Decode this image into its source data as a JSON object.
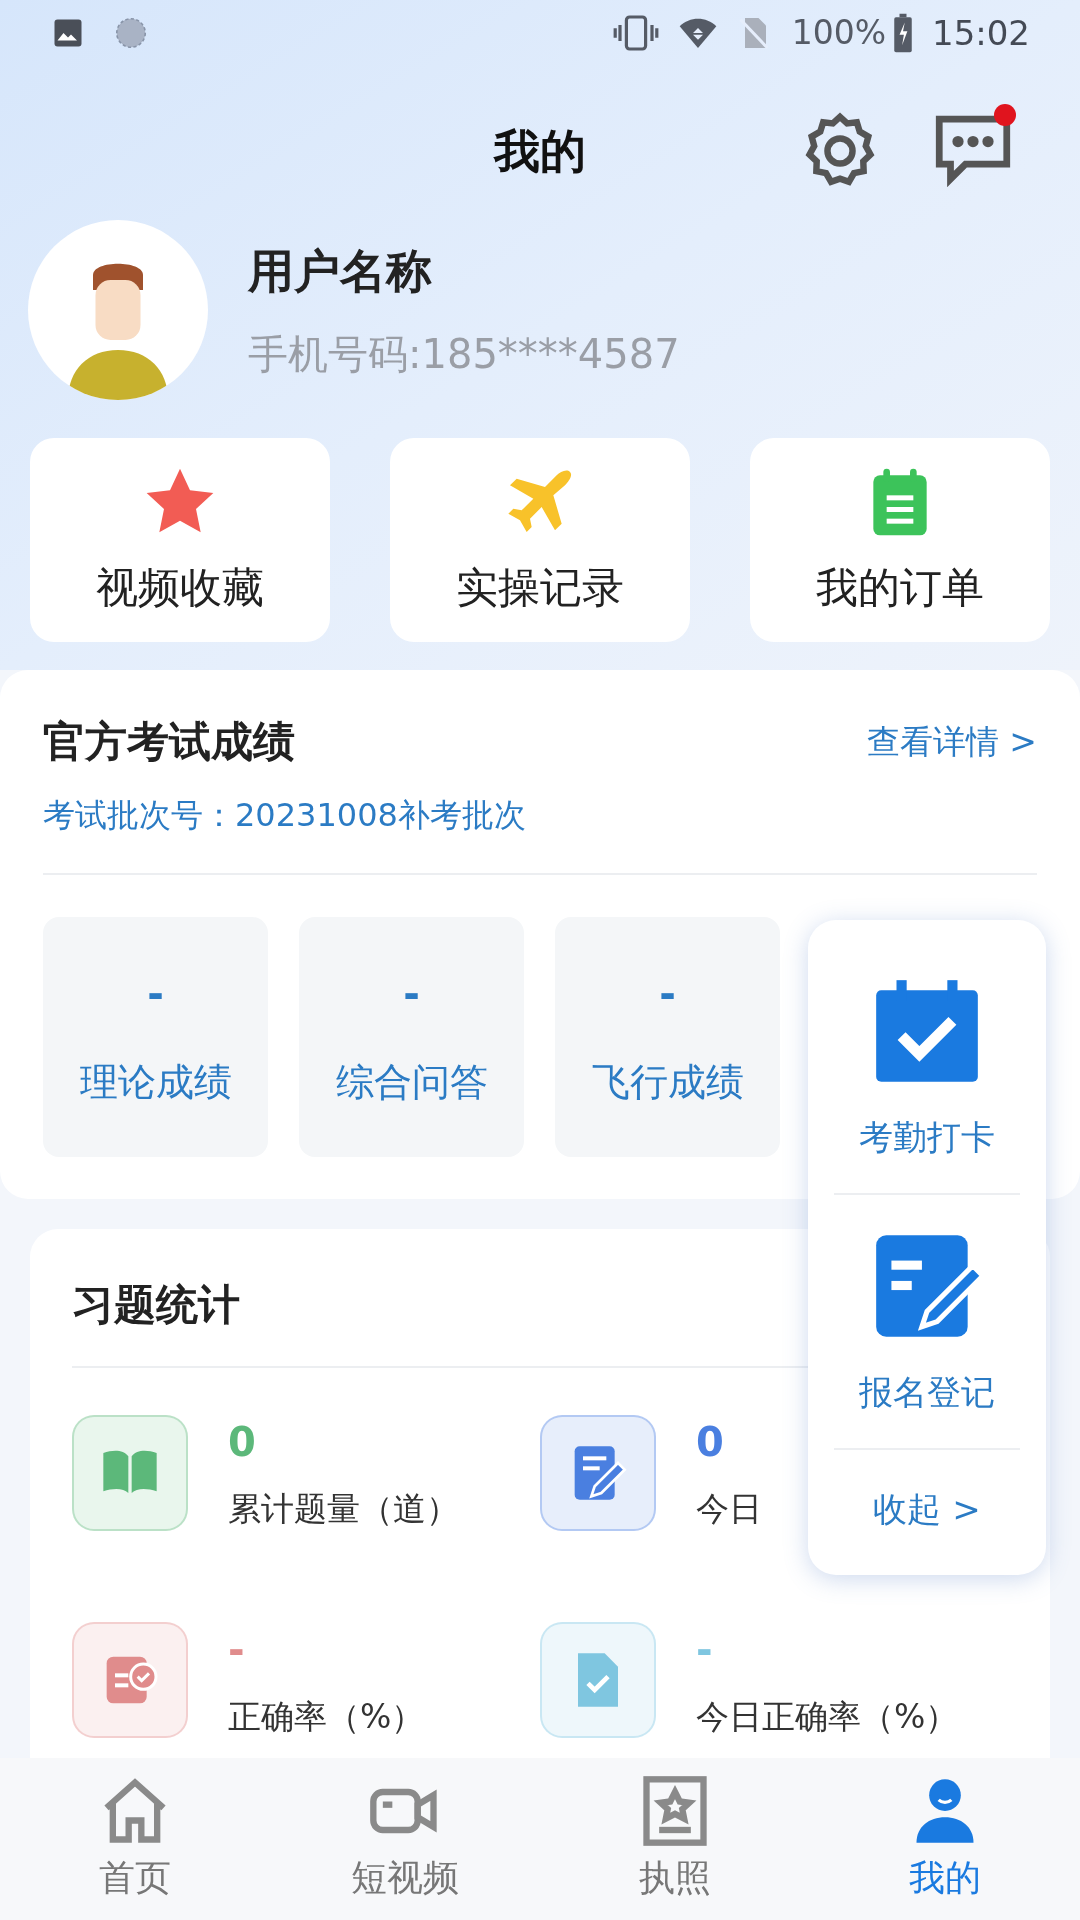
{
  "status_bar": {
    "battery": "100%",
    "time": "15:02"
  },
  "header": {
    "title": "我的",
    "has_unread": true
  },
  "profile": {
    "name": "用户名称",
    "phone": "手机号码:185****4587"
  },
  "shortcuts": [
    {
      "kind": "star",
      "label": "视频收藏"
    },
    {
      "kind": "plane",
      "label": "实操记录"
    },
    {
      "kind": "clipboard",
      "label": "我的订单"
    }
  ],
  "exam": {
    "title": "官方考试成绩",
    "link": "查看详情 >",
    "batch": "考试批次号：20231008补考批次",
    "scores": [
      {
        "value": "-",
        "label": "理论成绩"
      },
      {
        "value": "-",
        "label": "综合问答"
      },
      {
        "value": "-",
        "label": "飞行成绩"
      }
    ]
  },
  "practice": {
    "title": "习题统计",
    "items": [
      {
        "kind": "book",
        "color": "#5cb87a",
        "value": "0",
        "label": "累计题量（道）"
      },
      {
        "kind": "pen",
        "color": "#4a7fe0",
        "value": "0",
        "label": "今日"
      },
      {
        "kind": "report",
        "color": "#e08c8c",
        "value": "-",
        "label": "正确率（%）"
      },
      {
        "kind": "doc",
        "color": "#7fc6e0",
        "value": "-",
        "label": "今日正确率（%）"
      }
    ]
  },
  "float_panel": {
    "items": [
      {
        "kind": "calendar",
        "label": "考勤打卡"
      },
      {
        "kind": "edit",
        "label": "报名登记"
      }
    ],
    "collapse": "收起 >"
  },
  "tabs": [
    {
      "kind": "home",
      "label": "首页",
      "selected": false
    },
    {
      "kind": "video",
      "label": "短视频",
      "selected": false
    },
    {
      "kind": "license",
      "label": "执照",
      "selected": false
    },
    {
      "kind": "user",
      "label": "我的",
      "selected": true
    }
  ]
}
